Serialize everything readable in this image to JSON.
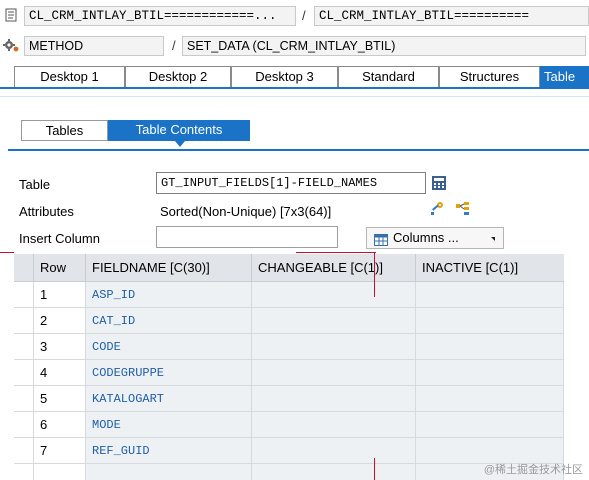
{
  "header": {
    "class_field_1": "CL_CRM_INTLAY_BTIL============...",
    "class_field_2": "CL_CRM_INTLAY_BTIL==========",
    "row1_sep": "/",
    "method_label": "METHOD",
    "row2_sep": "/",
    "method_value": "SET_DATA (CL_CRM_INTLAY_BTIL)"
  },
  "top_tabs": [
    {
      "label": "Desktop 1"
    },
    {
      "label": "Desktop 2"
    },
    {
      "label": "Desktop 3"
    },
    {
      "label": "Standard"
    },
    {
      "label": "Structures"
    },
    {
      "label": "Table"
    }
  ],
  "inner_tabs": [
    {
      "label": "Tables"
    },
    {
      "label": "Table Contents"
    }
  ],
  "form": {
    "table_label": "Table",
    "table_value": "GT_INPUT_FIELDS[1]-FIELD_NAMES",
    "attributes_label": "Attributes",
    "attributes_value": "Sorted(Non-Unique) [7x3(64)]",
    "insert_column_label": "Insert Column",
    "insert_column_value": "",
    "columns_button": "Columns ..."
  },
  "grid": {
    "headers": [
      "Row",
      "FIELDNAME [C(30)]",
      "CHANGEABLE [C(1)]",
      "INACTIVE [C(1)]"
    ],
    "rows": [
      {
        "row": "1",
        "fieldname": "ASP_ID",
        "changeable": "",
        "inactive": ""
      },
      {
        "row": "2",
        "fieldname": "CAT_ID",
        "changeable": "",
        "inactive": ""
      },
      {
        "row": "3",
        "fieldname": "CODE",
        "changeable": "",
        "inactive": ""
      },
      {
        "row": "4",
        "fieldname": "CODEGRUPPE",
        "changeable": "",
        "inactive": ""
      },
      {
        "row": "5",
        "fieldname": "KATALOGART",
        "changeable": "",
        "inactive": ""
      },
      {
        "row": "6",
        "fieldname": "MODE",
        "changeable": "",
        "inactive": ""
      },
      {
        "row": "7",
        "fieldname": "REF_GUID",
        "changeable": "",
        "inactive": ""
      }
    ]
  },
  "watermark": "@稀土掘金技术社区",
  "colors": {
    "accent": "#1a73c6",
    "marker": "#c8102e"
  }
}
